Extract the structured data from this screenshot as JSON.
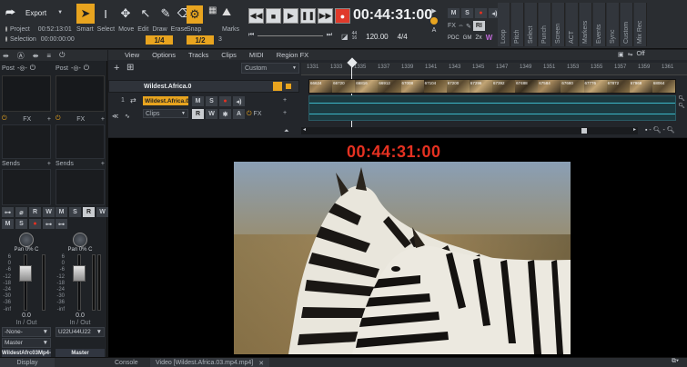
{
  "toolbar": {
    "export_label": "Export",
    "project_label": "Project",
    "project_time": "00:52:13:01",
    "selection_label": "Selection",
    "selection_time": "00:00:00:00",
    "tools": [
      "Smart",
      "Select",
      "Move",
      "Edit",
      "Draw",
      "Erase"
    ],
    "snap_label": "Snap",
    "snap_value": "1/4",
    "snap_value2": "1/2",
    "snap_beats": "3",
    "marks_label": "Marks",
    "timecode": "00:44:31:00",
    "sample_rate_top": "44",
    "sample_rate_bottom": "16",
    "tempo": "120.00",
    "meter": "4/4",
    "fx_label": "FX",
    "ri_label": "RI",
    "pdc_label": "PDC",
    "gm_label": "GM",
    "speed_label": "2x",
    "w_label": "W",
    "vtabs": [
      "Loop",
      "Pitch",
      "Select",
      "Punch",
      "Screen",
      "ACT",
      "Markers",
      "Events",
      "Sync",
      "Custom",
      "Mix Rec"
    ]
  },
  "console": {
    "strip1": {
      "post": "Post",
      "fx": "FX",
      "sends": "Sends",
      "pan": "Pan",
      "pan_value": "0% C",
      "level": "0.0",
      "io": "In / Out",
      "input": "-None-",
      "output": "Master",
      "name": "WildestAfrc03Mp4-",
      "number": "1"
    },
    "strip2": {
      "post": "Post",
      "fx": "FX",
      "sends": "Sends",
      "pan": "Pan",
      "pan_value": "0% C",
      "level": "0.0",
      "io": "In / Out",
      "output": "U22U44U22",
      "name": "Master",
      "number": "A"
    },
    "scale": [
      "6",
      "0",
      "-6",
      "-12",
      "-18",
      "-24",
      "-30",
      "-36",
      "-inf"
    ]
  },
  "trackview": {
    "menus": [
      "View",
      "Options",
      "Tracks",
      "Clips",
      "MIDI",
      "Region FX"
    ],
    "custom_label": "Custom",
    "track_folder_name": "Wildest.Africa.0",
    "track_number": "1",
    "track_name": "Wildest.Africa.03",
    "clips_label": "Clips",
    "fx_label": "FX",
    "off_label": "Off",
    "ruler": [
      "1331",
      "1333",
      "1335",
      "1337",
      "1339",
      "1341",
      "1343",
      "1345",
      "1347",
      "1349",
      "1351",
      "1353",
      "1355",
      "1357",
      "1359",
      "1361"
    ],
    "thumb_labels": [
      "66624",
      "66720",
      "66816",
      "66912",
      "67008",
      "67104",
      "67200",
      "67296",
      "67392",
      "67488",
      "67584",
      "67680",
      "67776",
      "67872",
      "67968",
      "68064"
    ]
  },
  "video": {
    "timecode": "00:44:31:00"
  },
  "bottom": {
    "display_tab": "Display",
    "console_tab": "Console",
    "video_tab": "Video [Wildest.Africa.03.mp4.mp4]"
  }
}
